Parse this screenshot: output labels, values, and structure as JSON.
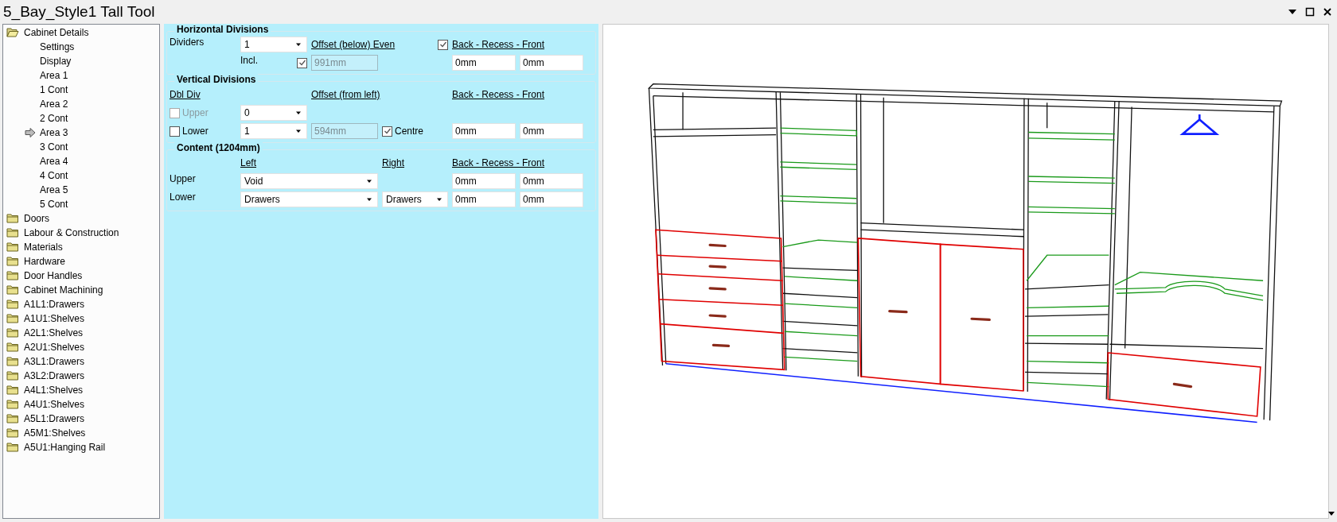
{
  "window": {
    "title": "5_Bay_Style1 Tall Tool"
  },
  "tree": [
    {
      "label": "Cabinet Details",
      "expanded": true,
      "children": [
        {
          "label": "Settings",
          "selected": false
        },
        {
          "label": "Display",
          "selected": false
        },
        {
          "label": "Area 1",
          "selected": false
        },
        {
          "label": "1 Cont",
          "selected": false
        },
        {
          "label": "Area 2",
          "selected": false
        },
        {
          "label": "2 Cont",
          "selected": false
        },
        {
          "label": "Area 3",
          "selected": true
        },
        {
          "label": "3 Cont",
          "selected": false
        },
        {
          "label": "Area 4",
          "selected": false
        },
        {
          "label": "4 Cont",
          "selected": false
        },
        {
          "label": "Area 5",
          "selected": false
        },
        {
          "label": "5 Cont",
          "selected": false
        }
      ]
    },
    {
      "label": "Doors",
      "expanded": false
    },
    {
      "label": "Labour & Construction",
      "expanded": false
    },
    {
      "label": "Materials",
      "expanded": false
    },
    {
      "label": "Hardware",
      "expanded": false
    },
    {
      "label": "Door Handles",
      "expanded": false
    },
    {
      "label": "Cabinet Machining",
      "expanded": false
    },
    {
      "label": "A1L1:Drawers",
      "expanded": false
    },
    {
      "label": "A1U1:Shelves",
      "expanded": false
    },
    {
      "label": "A2L1:Shelves",
      "expanded": false
    },
    {
      "label": "A2U1:Shelves",
      "expanded": false
    },
    {
      "label": "A3L1:Drawers",
      "expanded": false
    },
    {
      "label": "A3L2:Drawers",
      "expanded": false
    },
    {
      "label": "A4L1:Shelves",
      "expanded": false
    },
    {
      "label": "A4U1:Shelves",
      "expanded": false
    },
    {
      "label": "A5L1:Drawers",
      "expanded": false
    },
    {
      "label": "A5M1:Shelves",
      "expanded": false
    },
    {
      "label": "A5U1:Hanging Rail",
      "expanded": false
    }
  ],
  "sections": [
    {
      "title": "Horizontal Divisions",
      "rows": [
        [
          {
            "kind": "label",
            "text": "Dividers"
          },
          {
            "kind": "combo",
            "value": "1"
          },
          {
            "kind": "heading",
            "text": "Offset (below) Even"
          },
          {
            "kind": "check",
            "checked": true,
            "disabled": false
          },
          {
            "kind": "heading",
            "text": "Back - Recess - Front"
          }
        ],
        [
          "",
          [
            {
              "kind": "label",
              "text": "Incl."
            },
            {
              "kind": "check",
              "checked": true,
              "disabled": false
            }
          ],
          {
            "kind": "field",
            "value": "991mm",
            "disabled": true
          },
          "",
          {
            "kind": "field",
            "value": "0mm",
            "disabled": false
          },
          {
            "kind": "field",
            "value": "0mm",
            "disabled": false
          }
        ]
      ]
    },
    {
      "title": "Vertical Divisions",
      "rows": [
        [
          {
            "kind": "heading",
            "text": "Dbl Div"
          },
          "",
          {
            "kind": "heading",
            "text": "Offset (from left)"
          },
          "",
          {
            "kind": "heading",
            "text": "Back - Recess - Front"
          }
        ],
        [
          {
            "kind": "check",
            "label": "Upper",
            "checked": false,
            "disabled": true
          },
          {
            "kind": "combo",
            "value": "0"
          }
        ],
        [
          {
            "kind": "check",
            "label": "Lower",
            "checked": false,
            "disabled": false
          },
          {
            "kind": "combo",
            "value": "1"
          },
          {
            "kind": "field",
            "value": "594mm",
            "disabled": true
          },
          {
            "kind": "check",
            "label": "Centre",
            "checked": true,
            "disabled": false
          },
          {
            "kind": "field",
            "value": "0mm",
            "disabled": false
          },
          {
            "kind": "field",
            "value": "0mm",
            "disabled": false
          }
        ]
      ]
    },
    {
      "title": "Content (1204mm)",
      "rows": [
        [
          "",
          {
            "kind": "heading",
            "text": "Left"
          },
          "",
          {
            "kind": "heading",
            "text": "Right"
          },
          {
            "kind": "heading",
            "text": "Back - Recess - Front"
          }
        ],
        [
          {
            "kind": "label",
            "text": "Upper"
          },
          {
            "kind": "combo",
            "value": "Void"
          },
          "",
          "",
          {
            "kind": "field",
            "value": "0mm",
            "disabled": false
          },
          {
            "kind": "field",
            "value": "0mm",
            "disabled": false
          }
        ],
        [
          {
            "kind": "label",
            "text": "Lower"
          },
          {
            "kind": "combo",
            "value": "Drawers"
          },
          "",
          {
            "kind": "combo",
            "value": "Drawers"
          },
          {
            "kind": "field",
            "value": "0mm",
            "disabled": false
          },
          {
            "kind": "field",
            "value": "0mm",
            "disabled": false
          }
        ]
      ]
    }
  ]
}
